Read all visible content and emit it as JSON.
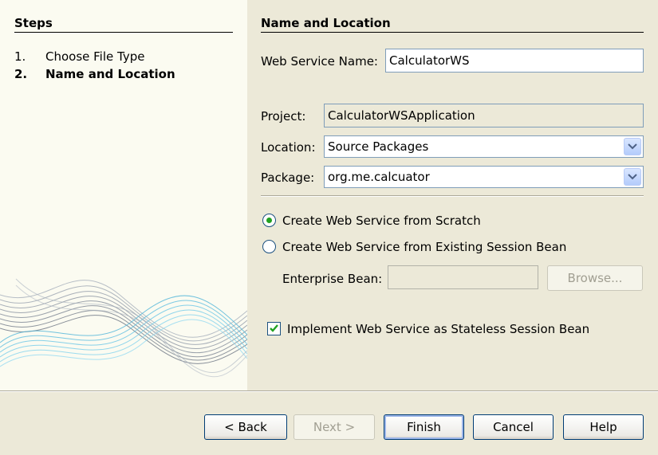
{
  "steps": {
    "title": "Steps",
    "items": [
      {
        "num": "1.",
        "label": "Choose File Type"
      },
      {
        "num": "2.",
        "label": "Name and Location"
      }
    ]
  },
  "panel": {
    "title": "Name and Location",
    "web_service_name_label": "Web Service Name:",
    "web_service_name_value": "CalculatorWS",
    "project_label": "Project:",
    "project_value": "CalculatorWSApplication",
    "location_label": "Location:",
    "location_value": "Source Packages",
    "package_label": "Package:",
    "package_value": "org.me.calcuator",
    "radio_scratch_label": "Create Web Service from Scratch",
    "radio_session_label": "Create Web Service from Existing Session Bean",
    "enterprise_bean_label": "Enterprise Bean:",
    "enterprise_bean_value": "",
    "browse_label": "Browse...",
    "checkbox_label": "Implement Web Service as Stateless Session Bean",
    "checkbox_checked": true,
    "selected_radio": "scratch"
  },
  "buttons": {
    "back": "< Back",
    "next": "Next >",
    "finish": "Finish",
    "cancel": "Cancel",
    "help": "Help"
  },
  "colors": {
    "dialog_bg": "#ece9d8",
    "left_panel_bg": "#fbfbf1",
    "accent_check": "#21a121",
    "button_border": "#003c74"
  }
}
